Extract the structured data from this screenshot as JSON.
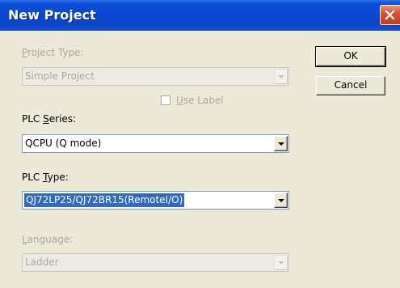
{
  "window": {
    "title": "New Project"
  },
  "buttons": {
    "ok": "OK",
    "cancel": "Cancel"
  },
  "project_type": {
    "label_prefix": "",
    "label_mnemonic": "P",
    "label_rest": "roject Type:",
    "value": "Simple Project",
    "enabled": false
  },
  "use_label": {
    "mnemonic": "U",
    "rest": "se Label",
    "checked": false,
    "enabled": false
  },
  "plc_series": {
    "label_prefix": "PLC ",
    "label_mnemonic": "S",
    "label_rest": "eries:",
    "value": "QCPU (Q mode)"
  },
  "plc_type": {
    "label_prefix": "PLC ",
    "label_mnemonic": "T",
    "label_rest": "ype:",
    "value": "QJ72LP25/QJ72BR15(RemoteI/O)"
  },
  "language": {
    "label_prefix": "",
    "label_mnemonic": "L",
    "label_rest": "anguage:",
    "value": "Ladder",
    "enabled": false
  },
  "icons": {
    "close": "close-icon",
    "dropdown": "chevron-down-icon"
  },
  "colors": {
    "titlebar": "#0A48D2",
    "face": "#ECE9D8",
    "selection": "#316AC5",
    "close": "#C43B22"
  }
}
